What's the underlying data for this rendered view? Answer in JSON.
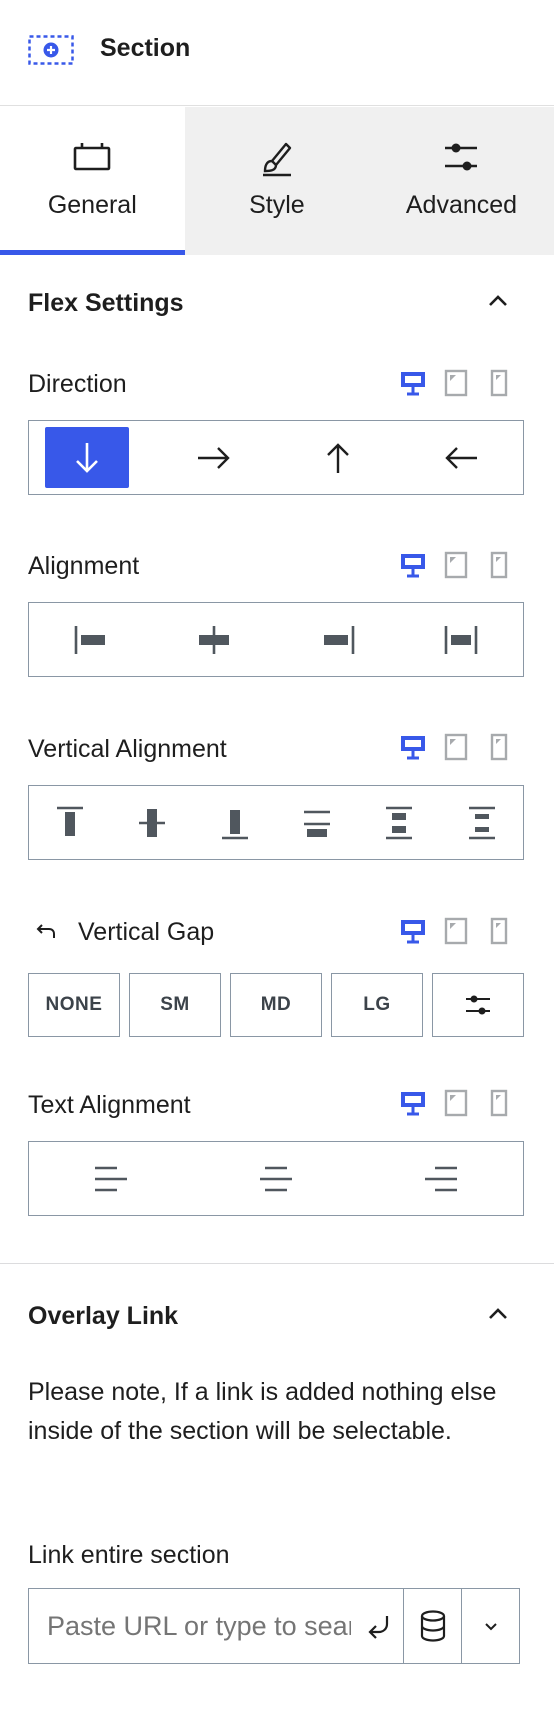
{
  "header": {
    "title": "Section"
  },
  "tabs": [
    {
      "label": "General",
      "active": true
    },
    {
      "label": "Style",
      "active": false
    },
    {
      "label": "Advanced",
      "active": false
    }
  ],
  "flex_settings": {
    "title": "Flex Settings",
    "direction": {
      "label": "Direction",
      "selected": "down"
    },
    "alignment": {
      "label": "Alignment"
    },
    "vertical_alignment": {
      "label": "Vertical Alignment"
    },
    "vertical_gap": {
      "label": "Vertical Gap",
      "options": [
        "NONE",
        "SM",
        "MD",
        "LG"
      ]
    },
    "text_alignment": {
      "label": "Text Alignment"
    }
  },
  "overlay_link": {
    "title": "Overlay Link",
    "note": "Please note, If a link is added nothing else inside of the section will be selectable.",
    "field_label": "Link entire section",
    "placeholder": "Paste URL or type to search"
  },
  "colors": {
    "accent": "#3858e9",
    "icon": "#50575e",
    "border": "#8a97a5",
    "tab_bg": "#f0f0f0"
  }
}
